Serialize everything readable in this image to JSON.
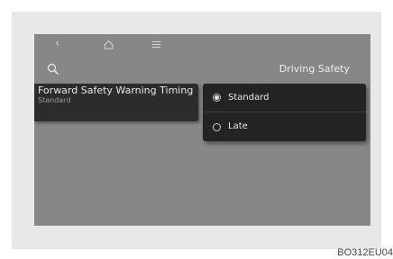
{
  "nav": {
    "back_icon": "chevron-left-icon",
    "home_icon": "home-icon",
    "menu_icon": "menu-icon",
    "search_icon": "search-icon"
  },
  "header": {
    "title": "Driving Safety"
  },
  "setting": {
    "title": "Forward Safety Warning Timing",
    "value": "Standard"
  },
  "options": [
    {
      "label": "Standard",
      "selected": true
    },
    {
      "label": "Late",
      "selected": false
    }
  ],
  "figure_code": "BO312EU04",
  "colors": {
    "screen": "#878787",
    "panel": "#232323",
    "text": "#e8e8e8"
  }
}
